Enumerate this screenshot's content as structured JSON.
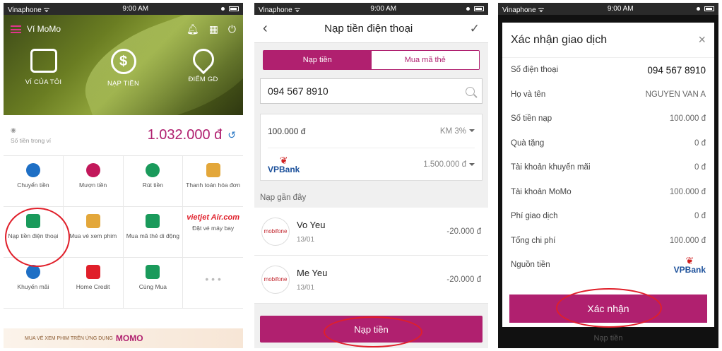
{
  "screen1": {
    "status": {
      "carrier": "Vinaphone ᯤ",
      "time": "9:00 AM"
    },
    "app_title": "Ví MoMo",
    "tiles": [
      {
        "label": "VÍ CỦA TÔI"
      },
      {
        "label": "NẠP TIỀN"
      },
      {
        "label": "ĐIỂM GD"
      }
    ],
    "balance_label": "Số tiền trong ví",
    "balance_amount": "1.032.000 đ",
    "grid": [
      {
        "label": "Chuyển tiền",
        "color": "#1e6fc5"
      },
      {
        "label": "Mượn tiền",
        "color": "#c2185b"
      },
      {
        "label": "Rút tiền",
        "color": "#1a9a5b"
      },
      {
        "label": "Thanh toán hóa đơn",
        "color": "#e3a73a"
      },
      {
        "label": "Nạp tiền điện thoại",
        "color": "#1a9a5b"
      },
      {
        "label": "Mua vé xem phim",
        "color": "#e3a73a"
      },
      {
        "label": "Mua mã thẻ di động",
        "color": "#1a9a5b"
      },
      {
        "label": "Đặt vé máy bay",
        "logo": "vietjet Air.com",
        "color": "#e01f2a"
      },
      {
        "label": "Khuyến mãi",
        "color": "#1e6fc5"
      },
      {
        "label": "Home Credit",
        "color": "#e01f2a"
      },
      {
        "label": "Cùng Mua",
        "color": "#1a9a5b"
      }
    ],
    "more_dots": "• • •",
    "banner_text": "MUA VÉ XEM PHIM TRÊN ỨNG DỤNG",
    "banner_brand": "MOMO"
  },
  "screen2": {
    "status": {
      "carrier": "Vinaphone ᯤ",
      "time": "9:00 AM"
    },
    "title": "Nạp tiền điện thoại",
    "tabs": {
      "active": "Nạp tiền",
      "inactive": "Mua mã thẻ"
    },
    "phone_value": "094 567 8910",
    "amount": "100.000 đ",
    "promo": "KM 3%",
    "bank": "VPBank",
    "bank_balance": "1.500.000 đ",
    "recent_header": "Nạp gần đây",
    "recent": [
      {
        "name": "Vo Yeu",
        "date": "13/01",
        "amount": "-20.000 đ",
        "logo": "mobifone"
      },
      {
        "name": "Me Yeu",
        "date": "13/01",
        "amount": "-20.000 đ",
        "logo": "mobifone"
      }
    ],
    "submit": "Nạp tiền"
  },
  "screen3": {
    "status": {
      "carrier": "Vinaphone ᯤ",
      "time": "9:00 AM"
    },
    "title": "Xác nhận giao dịch",
    "rows": [
      {
        "label": "Số điện thoại",
        "value": "094 567 8910"
      },
      {
        "label": "Họ và tên",
        "value": "NGUYEN VAN A"
      },
      {
        "label": "Số tiền nạp",
        "value": "100.000 đ"
      },
      {
        "label": "Quà tặng",
        "value": "0 đ"
      },
      {
        "label": "Tài khoản khuyến mãi",
        "value": "0 đ"
      },
      {
        "label": "Tài khoản MoMo",
        "value": "100.000 đ"
      },
      {
        "label": "Phí giao dịch",
        "value": "0 đ"
      },
      {
        "label": "Tổng chi phí",
        "value": "100.000 đ"
      }
    ],
    "source_label": "Nguồn tiền",
    "source_bank": "VPBank",
    "confirm": "Xác nhận",
    "under_button": "Nạp tiền"
  },
  "accent_color": "#b0206f",
  "highlight_color": "#e01f2a"
}
